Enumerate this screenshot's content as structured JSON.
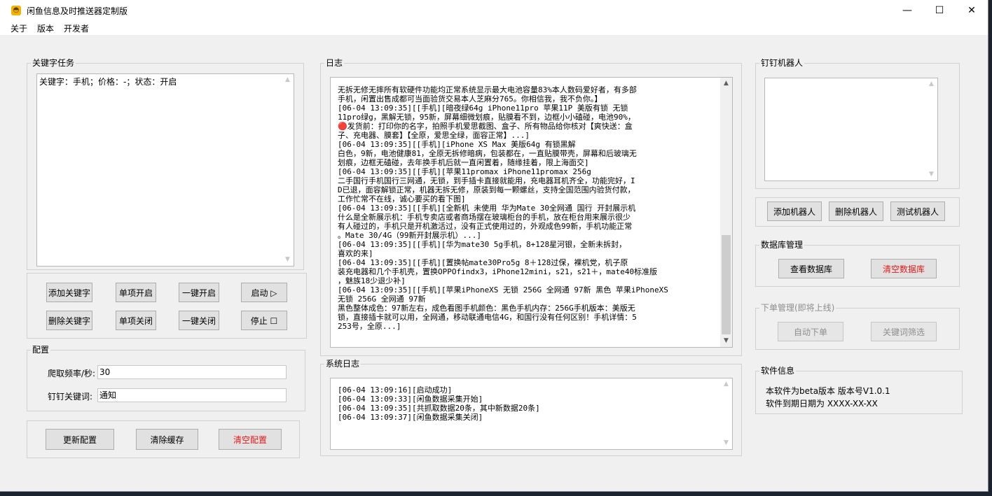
{
  "window": {
    "title": "闲鱼信息及时推送器定制版",
    "icon": "fish-app-icon"
  },
  "controls": {
    "minimize": "—",
    "maximize": "☐",
    "close": "✕"
  },
  "menu": [
    "关于",
    "版本",
    "开发者"
  ],
  "keyword_tasks": {
    "title": "关键字任务",
    "text": "关键字：手机；价格：-；状态：开启"
  },
  "task_buttons": {
    "add_keyword": "添加关键字",
    "single_start": "单项开启",
    "start_all": "一键开启",
    "start": "启动 ▷",
    "delete_keyword": "删除关键字",
    "single_stop": "单项关闭",
    "stop_all": "一键关闭",
    "stop": "停止 ☐"
  },
  "config": {
    "title": "配置",
    "crawl_freq_label": "爬取频率/秒:",
    "crawl_freq_value": "30",
    "dingtalk_keyword_label": "钉钉关键词:",
    "dingtalk_keyword_value": "通知"
  },
  "config_buttons": {
    "update": "更新配置",
    "clear_cache": "清除缓存",
    "clear_config": "清空配置"
  },
  "log": {
    "title": "日志",
    "lines": [
      "无拆无修无摔所有软硬件功能均正常系统显示最大电池容量83%本人数码爱好者，有多部",
      "手机，闲置出售成都可当面验货交易本人芝麻分765。你相信我，我不负你。】",
      "[06-04 13:09:35][[手机][暗夜绿64g iPhone11pro 苹果11P 美版有锁  无锁",
      "11pro绿g，黑解无锁，95新，屏幕细微划痕，贴膜看不到，边框小小磕碰，电池90%，",
      "🔴发货前：打印你的名字，拍照手机爱思截图、盒子、所有物品给你核对【爽快送：盒",
      "子、充电器、膜套】【全原，爱思全绿，面容正常】...]",
      "[06-04 13:09:35][[手机][iPhone XS Max 美版64g 有锁黑解",
      "白色，9新，电池健康81，全原无拆修暗病，包装都在，一直贴膜带壳，屏幕和后玻璃无",
      "划痕，边框无磕碰，去年换手机后就一直闲置着，随缘挂着，限上海面交]",
      "[06-04 13:09:35][[手机][苹果11promax iPhone11promax 256g",
      "二手国行手机国行三网通，无锁，到手插卡直接就能用，充电器耳机齐全，功能完好，I",
      "D已退，面容解锁正常，机器无拆无修，原装到每一颗螺丝，支持全国范围内验货付款，",
      "工作忙常不在线，诚心要买的看下图]",
      "[06-04 13:09:35][[手机][全新机 未使用 华为Mate 30全网通 国行 开封展示机",
      "什么是全新展示机：手机专卖店或者商场摆在玻璃柜台的手机，放在柜台用来展示很少",
      "有人碰过的，手机只是开机激活过，没有正式使用过的，外观成色99新，手机功能正常",
      "。Mate 30/4G（99新开封展示机）...]",
      "[06-04 13:09:35][[手机][华为mate30  5g手机，8+128星河银，全新未拆封，",
      "喜欢的来]",
      "[06-04 13:09:35][[手机][置换帖mate30Pro5g 8＋128过保，裸机党，机子原",
      "装充电器和几个手机壳，置换OPPOfindx3，iPhone12mini，s21，s21＋，mate40标准版",
      "，魅族18少退少补]",
      "[06-04 13:09:35][[手机][苹果iPhoneXS 无锁 256G 全网通 97新 黑色 苹果iPhoneXS",
      "无锁 256G 全网通 97新",
      "黑色整体成色：97新左右，成色看图手机颜色：黑色手机内存：256G手机版本：美版无",
      "锁，直接插卡就可以用，全网通，移动联通电信4G，和国行没有任何区别！手机详情：5",
      "253号，全原...]"
    ]
  },
  "system_log": {
    "title": "系统日志",
    "lines": [
      "[06-04 13:09:16][启动成功]",
      "[06-04 13:09:33][闲鱼数据采集开始]",
      "[06-04 13:09:35][共抓取数据20条，其中新数据20条]",
      "[06-04 13:09:37][闲鱼数据采集关闭]"
    ]
  },
  "dingtalk": {
    "title": "钉钉机器人",
    "add": "添加机器人",
    "delete": "删除机器人",
    "test": "测试机器人"
  },
  "database": {
    "title": "数据库管理",
    "view": "查看数据库",
    "clear": "清空数据库"
  },
  "order": {
    "title": "下单管理(即将上线)",
    "auto_order": "自动下单",
    "keyword_filter": "关键词筛选"
  },
  "software": {
    "title": "软件信息",
    "line1": "本软件为beta版本 版本号V1.0.1",
    "line2": "软件到期日期为 XXXX-XX-XX"
  }
}
